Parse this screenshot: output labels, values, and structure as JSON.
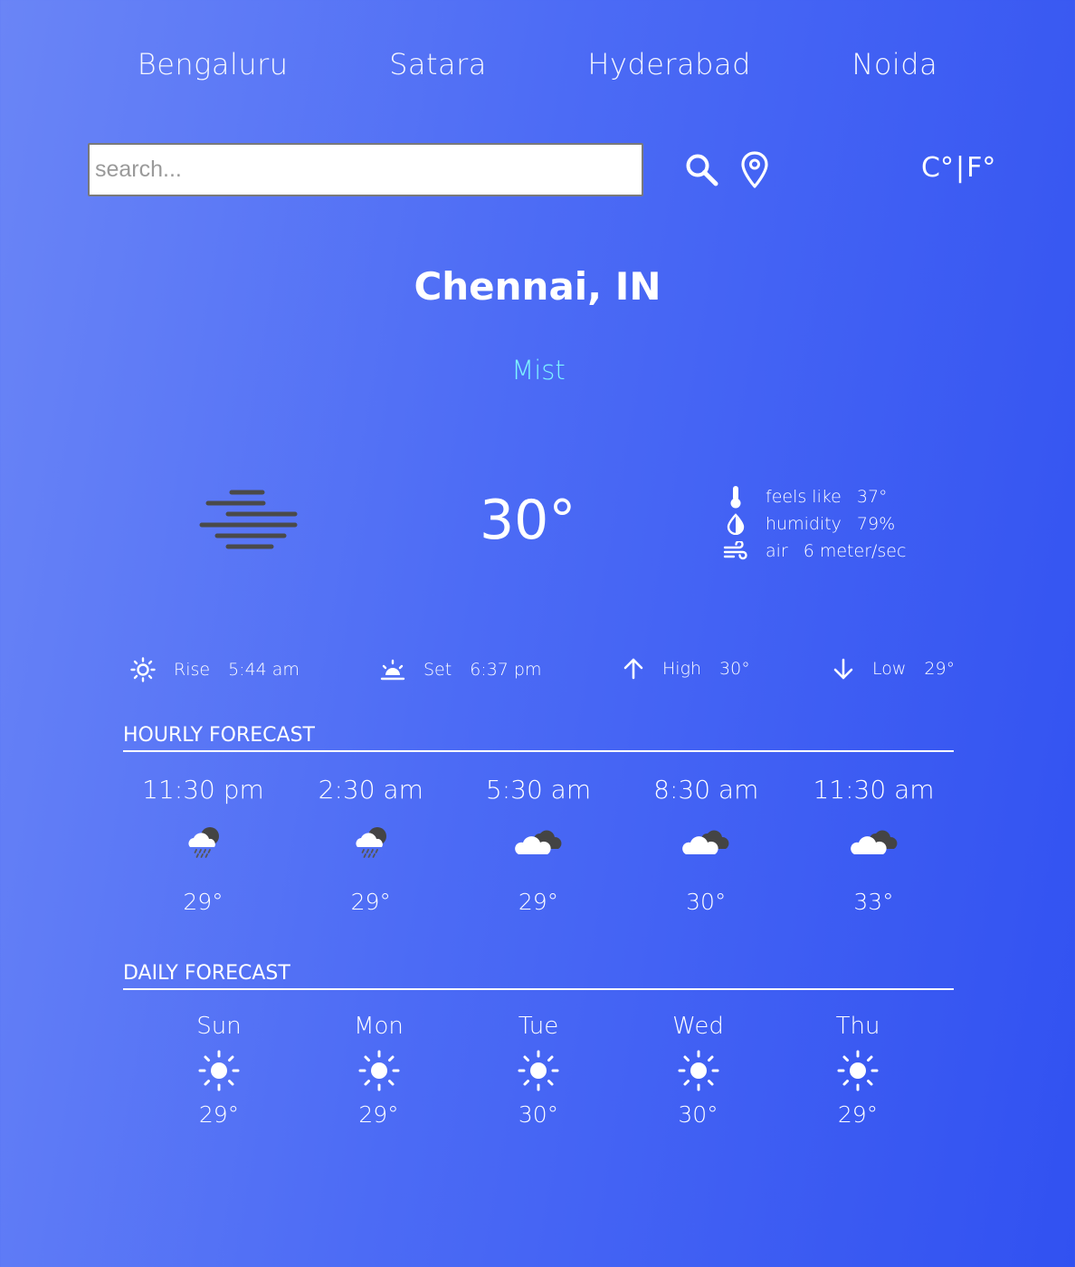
{
  "nav": {
    "cities": [
      "Bengaluru",
      "Satara",
      "Hyderabad",
      "Noida"
    ]
  },
  "search": {
    "placeholder": "search...",
    "value": ""
  },
  "units": {
    "celsius": "C°",
    "separator": "|",
    "fahrenheit": "F°"
  },
  "location": "Chennai, IN",
  "condition": "Mist",
  "current": {
    "temperature": "30°",
    "icon": "mist-icon",
    "details": [
      {
        "icon": "thermometer-icon",
        "label": "feels like",
        "value": "37°"
      },
      {
        "icon": "humidity-icon",
        "label": "humidity",
        "value": "79%"
      },
      {
        "icon": "wind-icon",
        "label": "air",
        "value": "6 meter/sec"
      }
    ]
  },
  "summary": [
    {
      "icon": "sunrise-icon",
      "label": "Rise",
      "value": "5:44 am"
    },
    {
      "icon": "sunset-icon",
      "label": "Set",
      "value": "6:37 pm"
    },
    {
      "icon": "arrow-up-icon",
      "label": "High",
      "value": "30°"
    },
    {
      "icon": "arrow-down-icon",
      "label": "Low",
      "value": "29°"
    }
  ],
  "hourly": {
    "title": "HOURLY FORECAST",
    "items": [
      {
        "time": "11:30 pm",
        "icon": "rain-cloud-icon",
        "temp": "29°"
      },
      {
        "time": "2:30 am",
        "icon": "rain-cloud-icon",
        "temp": "29°"
      },
      {
        "time": "5:30 am",
        "icon": "broken-clouds-icon",
        "temp": "29°"
      },
      {
        "time": "8:30 am",
        "icon": "broken-clouds-icon",
        "temp": "30°"
      },
      {
        "time": "11:30 am",
        "icon": "broken-clouds-icon",
        "temp": "33°"
      }
    ]
  },
  "daily": {
    "title": "DAILY FORECAST",
    "items": [
      {
        "day": "Sun",
        "icon": "sun-icon",
        "temp": "29°"
      },
      {
        "day": "Mon",
        "icon": "sun-icon",
        "temp": "29°"
      },
      {
        "day": "Tue",
        "icon": "sun-icon",
        "temp": "30°"
      },
      {
        "day": "Wed",
        "icon": "sun-icon",
        "temp": "30°"
      },
      {
        "day": "Thu",
        "icon": "sun-icon",
        "temp": "29°"
      }
    ]
  },
  "colors": {
    "background_start": "#6a85f6",
    "background_end": "#3151f1",
    "condition": "#7ef3ff",
    "text": "#ffffff"
  }
}
